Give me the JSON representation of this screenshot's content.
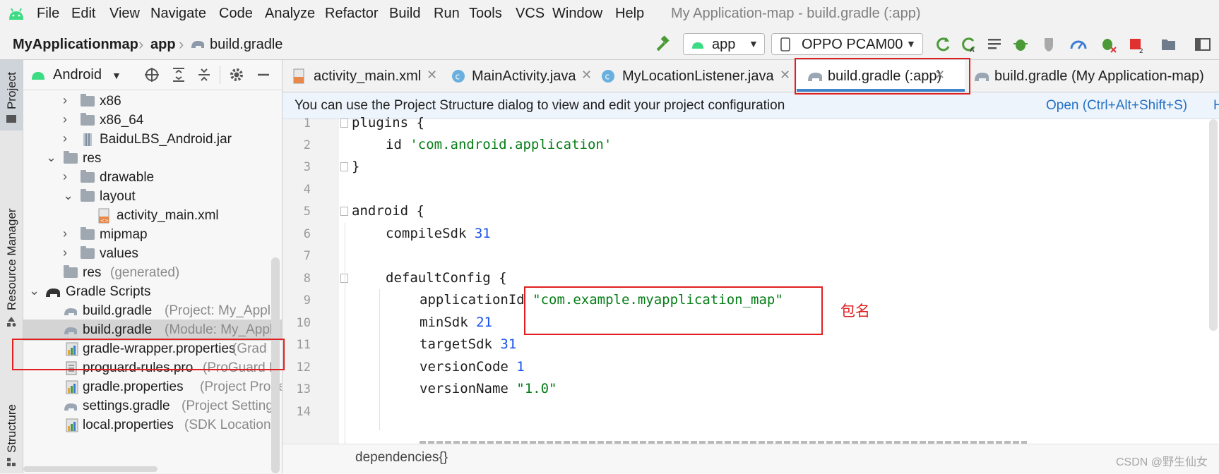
{
  "menubar": {
    "items": [
      "File",
      "Edit",
      "View",
      "Navigate",
      "Code",
      "Analyze",
      "Refactor",
      "Build",
      "Run",
      "Tools",
      "VCS",
      "Window",
      "Help"
    ],
    "window_title": "My Application-map - build.gradle (:app)"
  },
  "navbar": {
    "crumbs": [
      "MyApplicationmap",
      "app",
      "build.gradle"
    ],
    "run_config": "app",
    "device": "OPPO PCAM00"
  },
  "left_stripe": {
    "tabs": [
      "Project",
      "Resource Manager",
      "Structure"
    ]
  },
  "project_panel": {
    "view_mode": "Android",
    "rows": [
      {
        "label": "x86",
        "sub": ""
      },
      {
        "label": "x86_64",
        "sub": ""
      },
      {
        "label": "BaiduLBS_Android.jar",
        "sub": ""
      },
      {
        "label": "res",
        "sub": ""
      },
      {
        "label": "drawable",
        "sub": ""
      },
      {
        "label": "layout",
        "sub": ""
      },
      {
        "label": "activity_main.xml",
        "sub": ""
      },
      {
        "label": "mipmap",
        "sub": ""
      },
      {
        "label": "values",
        "sub": ""
      },
      {
        "label": "res",
        "sub": "(generated)"
      },
      {
        "label": "Gradle Scripts",
        "sub": ""
      },
      {
        "label": "build.gradle",
        "sub": "(Project: My_Applic"
      },
      {
        "label": "build.gradle",
        "sub": "(Module: My_Appli"
      },
      {
        "label": "gradle-wrapper.properties",
        "sub": "(Grad"
      },
      {
        "label": "proguard-rules.pro",
        "sub": "(ProGuard R"
      },
      {
        "label": "gradle.properties",
        "sub": "(Project Prope"
      },
      {
        "label": "settings.gradle",
        "sub": "(Project Settings"
      },
      {
        "label": "local.properties",
        "sub": "(SDK Location)"
      }
    ]
  },
  "tabs": [
    {
      "label": "activity_main.xml"
    },
    {
      "label": "MainActivity.java"
    },
    {
      "label": "MyLocationListener.java"
    },
    {
      "label": "build.gradle (:app)"
    },
    {
      "label": "build.gradle (My Application-map)"
    }
  ],
  "notice": {
    "text": "You can use the Project Structure dialog to view and edit your project configuration",
    "action": "Open (Ctrl+Alt+Shift+S)",
    "extra": "H"
  },
  "editor": {
    "line_numbers": [
      "1",
      "2",
      "3",
      "4",
      "5",
      "6",
      "7",
      "8",
      "9",
      "10",
      "11",
      "12",
      "13",
      "14"
    ],
    "lines": {
      "l1": "plugins {",
      "l2a": "id ",
      "l2b": "'com.android.application'",
      "l3": "}",
      "l5": "android {",
      "l6a": "compileSdk ",
      "l6b": "31",
      "l8": "defaultConfig {",
      "l9a": "applicationId ",
      "l9b": "\"com.example.myapplication_map\"",
      "l10a": "minSdk ",
      "l10b": "21",
      "l11a": "targetSdk ",
      "l11b": "31",
      "l12a": "versionCode ",
      "l12b": "1",
      "l13a": "versionName ",
      "l13b": "\"1.0\""
    },
    "breadcrumb": "dependencies{}"
  },
  "annotation": {
    "label": "包名",
    "color": "#e02020"
  },
  "watermark": "CSDN @野生仙女"
}
